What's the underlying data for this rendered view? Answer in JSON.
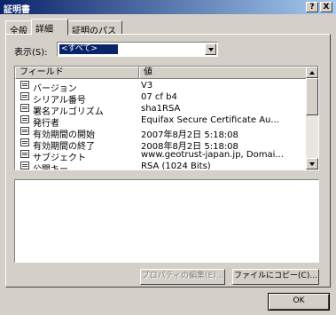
{
  "window": {
    "title": "証明書",
    "help_button": "?",
    "close_button": "X"
  },
  "tabs": [
    {
      "label": "全般"
    },
    {
      "label": "詳細"
    },
    {
      "label": "証明のパス"
    }
  ],
  "show": {
    "label": "表示(S):",
    "selected": "<すべて>"
  },
  "table": {
    "columns": [
      "フィールド",
      "値"
    ],
    "rows": [
      {
        "field": "バージョン",
        "value": "V3"
      },
      {
        "field": "シリアル番号",
        "value": "07 cf b4"
      },
      {
        "field": "署名アルゴリズム",
        "value": "sha1RSA"
      },
      {
        "field": "発行者",
        "value": "Equifax Secure Certificate Au..."
      },
      {
        "field": "有効期間の開始",
        "value": "2007年8月2日 5:18:08"
      },
      {
        "field": "有効期間の終了",
        "value": "2008年8月2日 5:18:08"
      },
      {
        "field": "サブジェクト",
        "value": "www.geotrust-japan.jp, Domai..."
      },
      {
        "field": "公開キー",
        "value": "RSA (1024 Bits)"
      }
    ]
  },
  "buttons": {
    "edit_properties": "プロパティの編集(E)...",
    "copy_to_file": "ファイルにコピー(C)...",
    "ok": "OK"
  },
  "colors": {
    "titlebar_start": "#0a246a",
    "titlebar_end": "#a6caf0",
    "face": "#d4d0c8",
    "selection": "#0a246a"
  }
}
